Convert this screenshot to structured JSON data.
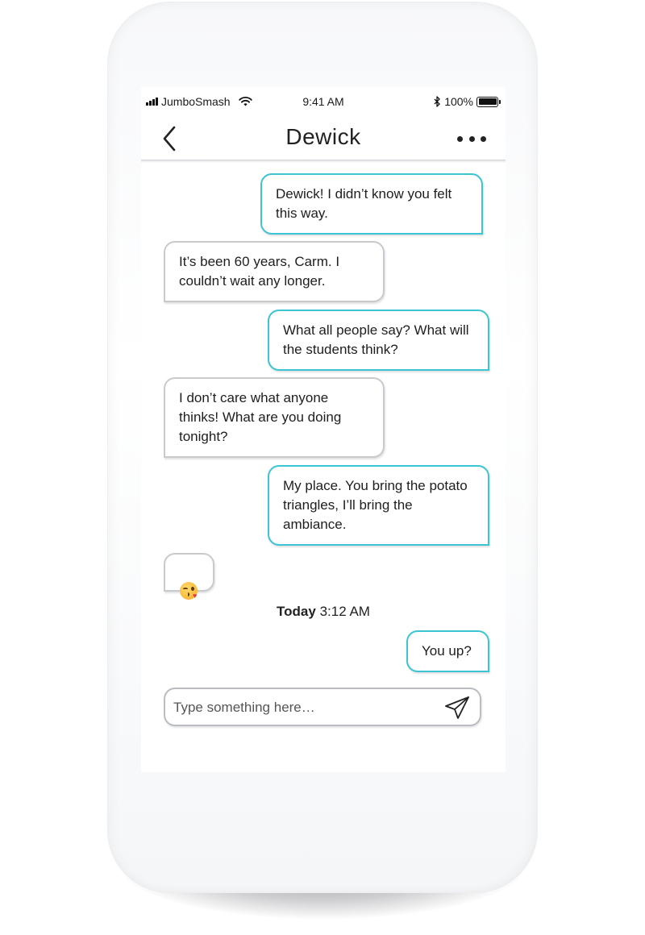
{
  "status_bar": {
    "carrier": "JumboSmash",
    "time": "9:41 AM",
    "battery": "100%",
    "icons": [
      "signal-bars-icon",
      "wifi-icon",
      "bluetooth-icon",
      "battery-icon"
    ]
  },
  "header": {
    "title": "Dewick",
    "back_icon": "chevron-left-icon",
    "more_icon": "ellipsis-icon"
  },
  "messages": [
    {
      "direction": "sent",
      "text": "Dewick! I didn’t know you felt\nthis way."
    },
    {
      "direction": "received",
      "text": "It’s been 60 years, Carm. I\ncouldn’t wait any longer."
    },
    {
      "direction": "sent",
      "text": "What all people say? What will\nthe students think?"
    },
    {
      "direction": "received",
      "text": "I don’t care what anyone\nthinks! What are you doing\ntonight?"
    },
    {
      "direction": "sent",
      "text": "My place. You bring the potato\ntriangles, I’ll bring the\nambiance."
    },
    {
      "direction": "received",
      "emoji": "face-blowing-a-kiss"
    },
    {
      "direction": "sent",
      "text": "You up?"
    }
  ],
  "timestamp": {
    "day": "Today",
    "time": "3:12 AM"
  },
  "composer": {
    "placeholder": "Type something here…",
    "value": "",
    "send_icon": "paper-plane-icon"
  },
  "colors": {
    "sent_border": "#3cc4d2",
    "received_border": "#c8cacd",
    "background": "#ffffff"
  }
}
